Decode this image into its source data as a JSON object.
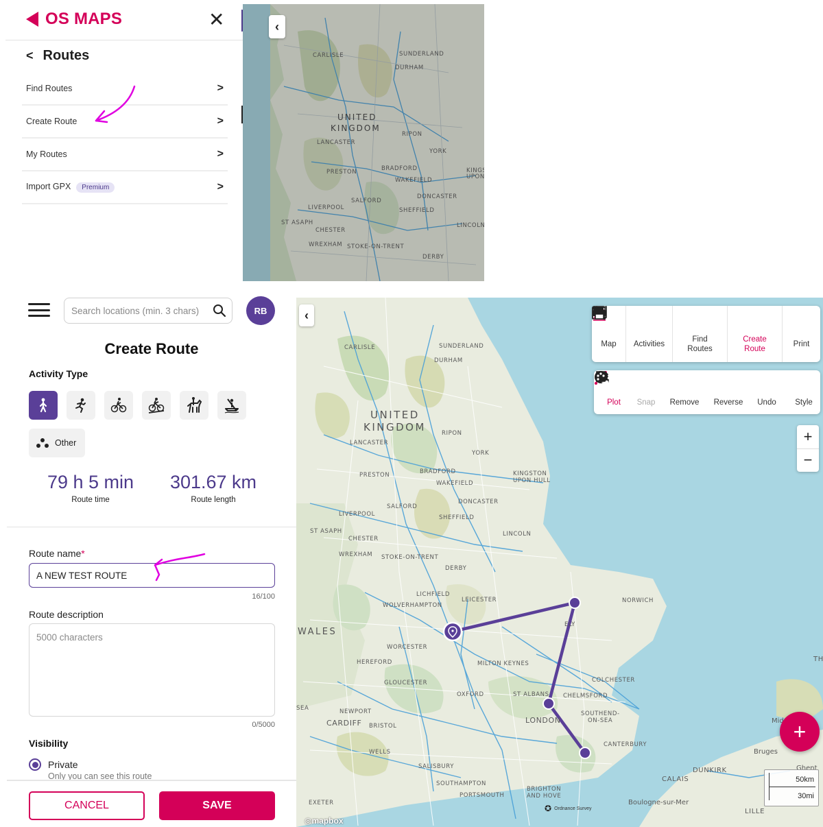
{
  "top": {
    "logo_text": "OS MAPS",
    "header": "Routes",
    "menu": [
      {
        "label": "Find Routes"
      },
      {
        "label": "Create Route"
      },
      {
        "label": "My Routes"
      },
      {
        "label": "Import GPX",
        "badge": "Premium"
      }
    ],
    "map_labels": {
      "carlisle": "CARLISLE",
      "sunderland": "SUNDERLAND",
      "durham": "DURHAM",
      "united": "UNITED",
      "kingdom": "KINGDOM",
      "ripon": "RIPON",
      "lancaster": "LANCASTER",
      "york": "YORK",
      "preston": "PRESTON",
      "bradford": "BRADFORD",
      "wakefield": "WAKEFIELD",
      "kingston": "KINGS",
      "upon": "UPON",
      "doncaster": "DONCASTER",
      "salford": "SALFORD",
      "liverpool": "LIVERPOOL",
      "sheffield": "SHEFFIELD",
      "st_asaph": "ST ASAPH",
      "chester": "CHESTER",
      "lincoln": "LINCOLN",
      "wrexham": "WREXHAM",
      "stoke": "STOKE-ON-TRENT",
      "derby": "DERBY"
    }
  },
  "panel": {
    "search_placeholder": "Search locations (min. 3 chars)",
    "avatar": "RB",
    "title": "Create Route",
    "activity_label": "Activity Type",
    "activities": [
      "walk-icon",
      "run-icon",
      "cycle-icon",
      "mountain-bike-icon",
      "horse-ride-icon",
      "kayak-icon"
    ],
    "other_label": "Other",
    "route_time": "79 h 5 min",
    "route_time_label": "Route time",
    "route_length": "301.67 km",
    "route_length_label": "Route length",
    "name_label": "Route name",
    "name_required": "*",
    "name_value": "A NEW TEST ROUTE",
    "name_counter": "16/100",
    "desc_label": "Route description",
    "desc_placeholder": "5000 characters",
    "desc_counter": "0/5000",
    "visibility_label": "Visibility",
    "visibility_option": "Private",
    "visibility_sub": "Only you can see this route",
    "cancel": "CANCEL",
    "save": "SAVE"
  },
  "map": {
    "top_toolbar": [
      {
        "icon": "map-icon",
        "label": "Map"
      },
      {
        "icon": "activities-icon",
        "label": "Activities"
      },
      {
        "icon": "find-routes-icon",
        "label1": "Find",
        "label2": "Routes"
      },
      {
        "icon": "create-route-icon",
        "label1": "Create",
        "label2": "Route"
      },
      {
        "icon": "print-icon",
        "label": "Print"
      }
    ],
    "edit_toolbar": [
      {
        "icon": "plot-icon",
        "label": "Plot"
      },
      {
        "icon": "snap-icon",
        "label": "Snap"
      },
      {
        "icon": "remove-icon",
        "label": "Remove"
      },
      {
        "icon": "reverse-icon",
        "label": "Reverse"
      },
      {
        "icon": "undo-icon",
        "label": "Undo"
      },
      {
        "icon": "style-icon",
        "label": "Style"
      }
    ],
    "zoom_in": "+",
    "zoom_out": "−",
    "fab": "+",
    "scale_km": "50km",
    "scale_mi": "30mi",
    "attribution": "mapbox",
    "os_credit": "Ordnance Survey",
    "labels": {
      "carlisle": "CARLISLE",
      "sunderland": "SUNDERLAND",
      "durham": "DURHAM",
      "united": "UNITED",
      "kingdom": "KINGDOM",
      "ripon": "RIPON",
      "lancaster": "LANCASTER",
      "york": "YORK",
      "preston": "PRESTON",
      "bradford": "BRADFORD",
      "kingston": "KINGSTON",
      "upon_hull": "UPON HULL",
      "wakefield": "WAKEFIELD",
      "doncaster": "DONCASTER",
      "salford": "SALFORD",
      "liverpool": "LIVERPOOL",
      "sheffield": "SHEFFIELD",
      "st_asaph": "ST ASAPH",
      "chester": "CHESTER",
      "lincoln": "LINCOLN",
      "wrexham": "WREXHAM",
      "stoke": "STOKE-ON-TRENT",
      "derby": "DERBY",
      "norwich": "NORWICH",
      "lichfield": "LICHFIELD",
      "leicester": "LEICESTER",
      "wolverhampton": "WOLVERHAMPTON",
      "ely": "ELY",
      "wales": "WALES",
      "worcester": "WORCESTER",
      "hereford": "HEREFORD",
      "milton_keynes": "MILTON KEYNES",
      "gloucester": "GLOUCESTER",
      "colchester": "COLCHESTER",
      "oxford": "OXFORD",
      "st_albans": "ST ALBANS",
      "chelmsford": "CHELMSFORD",
      "sea": "SEA",
      "newport": "NEWPORT",
      "cardiff": "CARDIFF",
      "bristol": "BRISTOL",
      "london": "LONDON",
      "southend": "SOUTHEND-",
      "on_sea": "ON-SEA",
      "canterbury": "CANTERBURY",
      "wells": "WELLS",
      "salisbury": "SALISBURY",
      "southampton": "SOUTHAMPTON",
      "portsmouth": "PORTSMOUTH",
      "brighton": "BRIGHTON",
      "and_hove": "AND HOVE",
      "exeter": "EXETER",
      "calais": "CALAIS",
      "dunkirk": "DUNKIRK",
      "bruges": "Bruges",
      "ghent": "Ghent",
      "boulogne": "Boulogne-sur-Mer",
      "lille": "LILLE",
      "mid": "Mid",
      "th": "TH"
    }
  }
}
